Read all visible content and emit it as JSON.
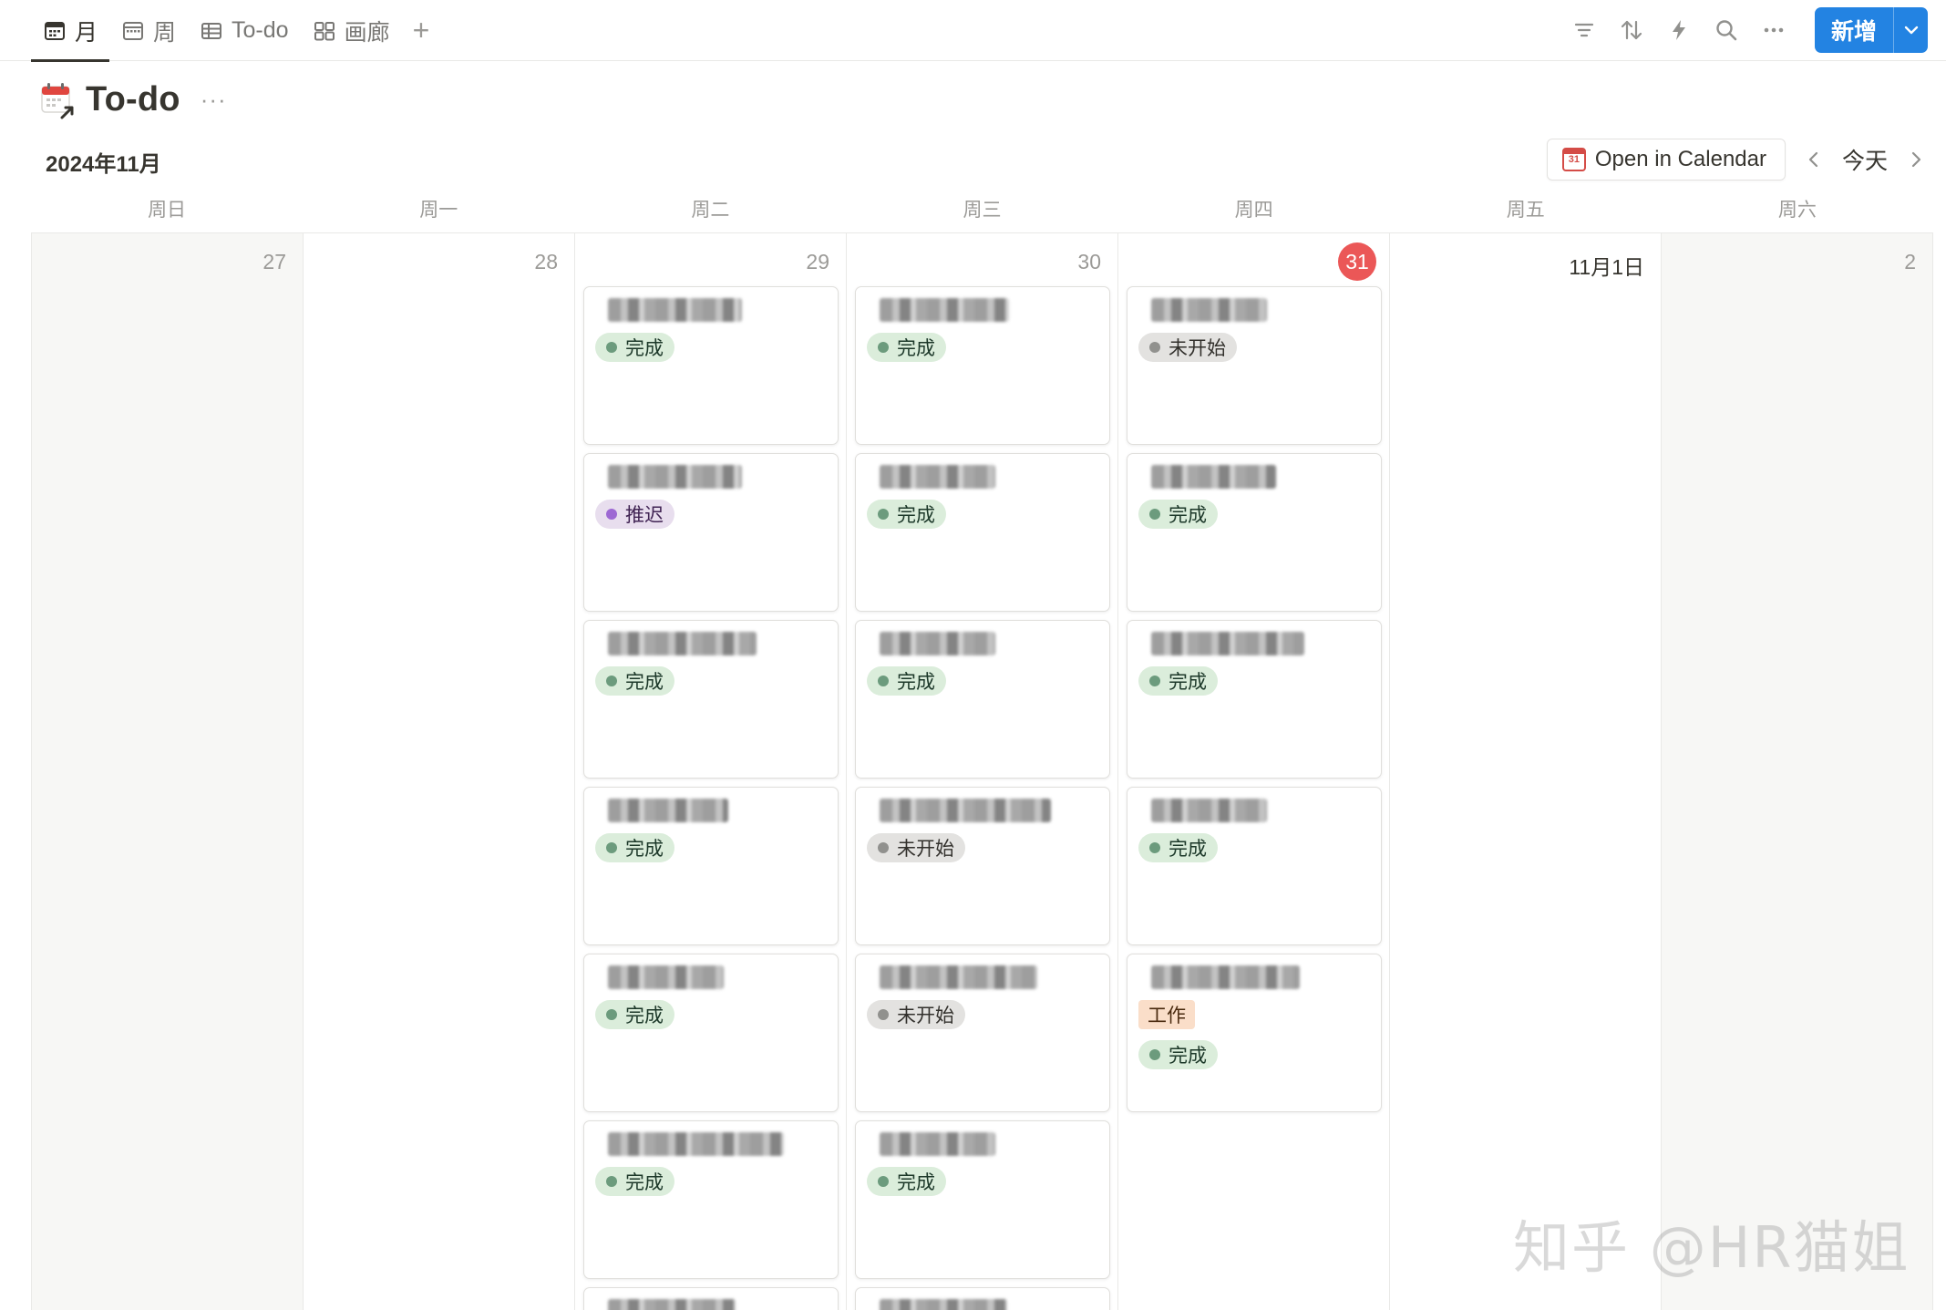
{
  "tabs": [
    {
      "label": "月",
      "icon": "calendar-month-icon",
      "active": true
    },
    {
      "label": "周",
      "icon": "calendar-week-icon",
      "active": false
    },
    {
      "label": "To-do",
      "icon": "table-icon",
      "active": false
    },
    {
      "label": "画廊",
      "icon": "gallery-icon",
      "active": false
    }
  ],
  "toolbar": {
    "icons": [
      "filter-icon",
      "sort-icon",
      "lightning-icon",
      "search-icon",
      "more-icon"
    ],
    "new_label": "新增",
    "accent": "#2383e2"
  },
  "page": {
    "title": "To-do",
    "more": "···",
    "icon": "calendar-shortcut-icon"
  },
  "calendar": {
    "month_label": "2024年11月",
    "open_in_calendar": "Open in Calendar",
    "today": "今天",
    "weekdays": [
      "周日",
      "周一",
      "周二",
      "周三",
      "周四",
      "周五",
      "周六"
    ],
    "days": [
      {
        "num": "27"
      },
      {
        "num": "28"
      },
      {
        "num": "29"
      },
      {
        "num": "30"
      },
      {
        "num": "31",
        "is_today": true
      },
      {
        "num": "11月1日"
      },
      {
        "num": "2"
      }
    ],
    "status_colors": {
      "完成": "#dbeddb",
      "未开始": "#e3e2e0",
      "推迟": "#e8deee",
      "today": "#eb5757"
    },
    "cards": {
      "tue": [
        {
          "status": "完成"
        },
        {
          "status": "推迟"
        },
        {
          "status": "完成"
        },
        {
          "status": "完成"
        },
        {
          "status": "完成"
        },
        {
          "status": "完成"
        }
      ],
      "wed": [
        {
          "status": "完成"
        },
        {
          "status": "完成"
        },
        {
          "status": "完成"
        },
        {
          "status": "未开始"
        },
        {
          "status": "未开始"
        },
        {
          "status": "完成"
        }
      ],
      "thu": [
        {
          "status": "未开始"
        },
        {
          "status": "完成"
        },
        {
          "status": "完成"
        },
        {
          "status": "完成"
        },
        {
          "label": "工作",
          "status": "完成"
        }
      ]
    }
  },
  "watermark": "知乎 @HR猫姐"
}
